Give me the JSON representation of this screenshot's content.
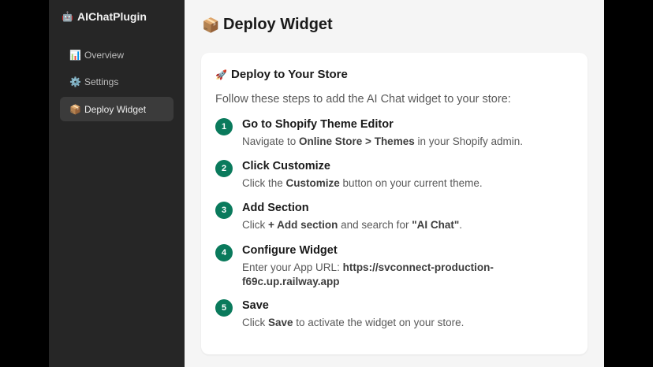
{
  "app": {
    "icon": "robot-icon",
    "name": "AIChatPlugin"
  },
  "sidebar": {
    "items": [
      {
        "icon": "chart-icon",
        "label": "Overview",
        "active": false
      },
      {
        "icon": "gear-icon",
        "label": "Settings",
        "active": false
      },
      {
        "icon": "package-icon",
        "label": "Deploy Widget",
        "active": true
      }
    ]
  },
  "page": {
    "icon": "package-icon",
    "title": "Deploy Widget"
  },
  "card": {
    "icon": "rocket-icon",
    "title": "Deploy to Your Store",
    "intro": "Follow these steps to add the AI Chat widget to your store:",
    "steps": [
      {
        "number": "1",
        "title": "Go to Shopify Theme Editor",
        "desc_pre": "Navigate to ",
        "desc_bold": "Online Store > Themes",
        "desc_post": " in your Shopify admin."
      },
      {
        "number": "2",
        "title": "Click Customize",
        "desc_pre": "Click the ",
        "desc_bold": "Customize",
        "desc_post": " button on your current theme."
      },
      {
        "number": "3",
        "title": "Add Section",
        "desc_pre": "Click ",
        "desc_bold": "+ Add section",
        "desc_mid": " and search for ",
        "desc_bold2": "\"AI Chat\"",
        "desc_post": "."
      },
      {
        "number": "4",
        "title": "Configure Widget",
        "desc_pre": "Enter your App URL: ",
        "desc_bold": "https://svconnect-production-f69c.up.railway.app",
        "desc_post": ""
      },
      {
        "number": "5",
        "title": "Save",
        "desc_pre": "Click ",
        "desc_bold": "Save",
        "desc_post": " to activate the widget on your store."
      }
    ]
  },
  "colors": {
    "step_badge": "#0a7a5c",
    "sidebar_bg": "#262626",
    "main_bg": "#f5f5f5"
  }
}
